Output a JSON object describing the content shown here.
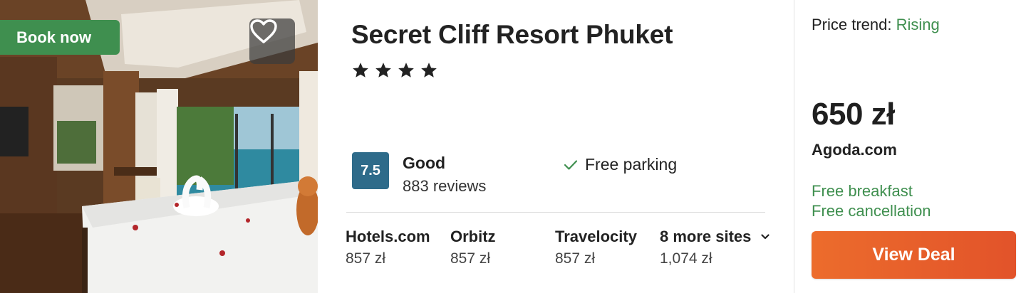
{
  "photo": {
    "book_now_label": "Book now",
    "favorite_icon": "heart-outline-icon"
  },
  "hotel": {
    "name": "Secret Cliff Resort Phuket",
    "star_count": 4,
    "score": "7.5",
    "rating_word": "Good",
    "reviews": "883 reviews",
    "amenity": "Free parking",
    "amenity_icon": "checkmark-icon"
  },
  "providers": [
    {
      "name": "Hotels.com",
      "price": "857 zł"
    },
    {
      "name": "Orbitz",
      "price": "857 zł"
    },
    {
      "name": "Travelocity",
      "price": "857 zł"
    },
    {
      "name": "8 more sites",
      "price": "1,074 zł"
    }
  ],
  "deal": {
    "trend_label": "Price trend:",
    "trend_value": "Rising",
    "price": "650 zł",
    "site": "Agoda.com",
    "perk_1": "Free breakfast",
    "perk_2": "Free cancellation",
    "cta_label": "View Deal"
  },
  "colors": {
    "green": "#3f8f4f",
    "score_badge": "#2e6b8a",
    "cta_orange": "#e8602b"
  }
}
